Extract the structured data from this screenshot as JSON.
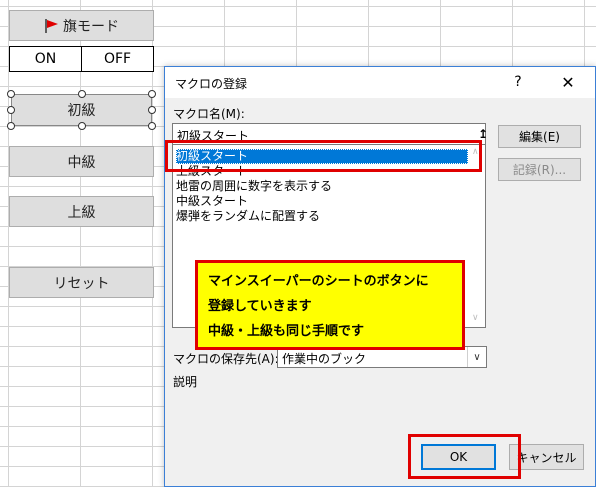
{
  "sheet": {
    "flag_button_label": "旗モード",
    "toggle_on": "ON",
    "toggle_off": "OFF",
    "beginner_button": "初級",
    "intermediate_button": "中級",
    "advanced_button": "上級",
    "reset_button": "リセット"
  },
  "dialog": {
    "title": "マクロの登録",
    "help_label": "?",
    "close_label": "✕",
    "macro_name_label": "マクロ名(M):",
    "macro_name_value": "初級スタート",
    "macro_list": [
      "初級スタート",
      "上級スタート",
      "地雷の周囲に数字を表示する",
      "中級スタート",
      "爆弾をランダムに配置する"
    ],
    "selected_index": 0,
    "edit_button": "編集(E)",
    "record_button": "記録(R)...",
    "store_in_label": "マクロの保存先(A):",
    "store_in_value": "作業中のブック",
    "description_label": "説明",
    "ok_button": "OK",
    "cancel_button": "キャンセル"
  },
  "annotation": {
    "line1": "マインスイーパーのシートのボタンに",
    "line2": "登録していきます",
    "line3": "中級・上級も同じ手順です"
  },
  "colors": {
    "highlight_red": "#e00000",
    "callout_yellow": "#ffff00",
    "selection_blue": "#0078d7"
  }
}
